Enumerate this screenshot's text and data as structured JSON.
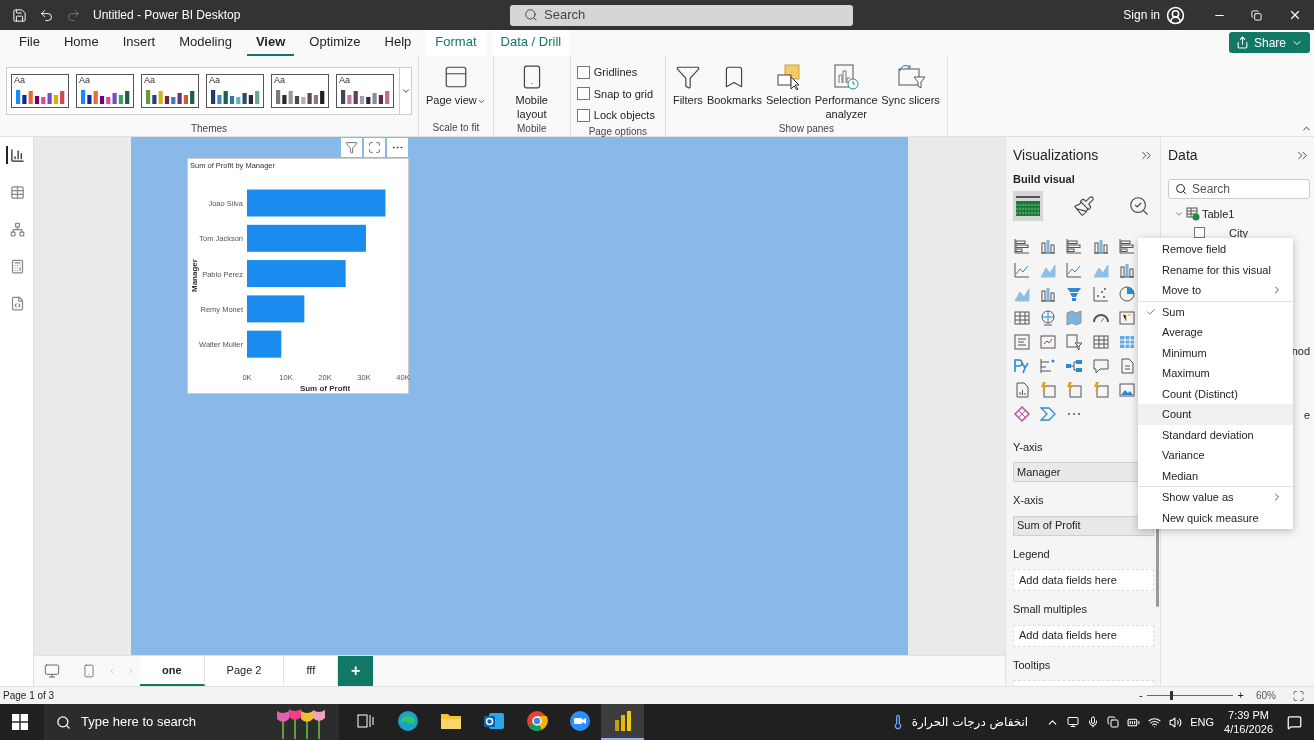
{
  "title_bar": {
    "title": "Untitled - Power BI Desktop",
    "search_placeholder": "Search",
    "sign_in": "Sign in"
  },
  "menu_tabs": [
    {
      "label": "File",
      "kind": "main",
      "selected": false
    },
    {
      "label": "Home",
      "kind": "main",
      "selected": false
    },
    {
      "label": "Insert",
      "kind": "main",
      "selected": false
    },
    {
      "label": "Modeling",
      "kind": "main",
      "selected": false
    },
    {
      "label": "View",
      "kind": "main",
      "selected": true
    },
    {
      "label": "Optimize",
      "kind": "main",
      "selected": false
    },
    {
      "label": "Help",
      "kind": "main",
      "selected": false
    },
    {
      "label": "Format",
      "kind": "contextual",
      "selected": false
    },
    {
      "label": "Data / Drill",
      "kind": "contextual",
      "selected": false
    }
  ],
  "share": "Share",
  "ribbon": {
    "themes_label": "Themes",
    "theme_swatches": [
      {
        "sample": "Aa"
      },
      {
        "sample": "Aa"
      },
      {
        "sample": "Aa"
      },
      {
        "sample": "Aa"
      },
      {
        "sample": "Aa"
      },
      {
        "sample": "Aa"
      }
    ],
    "groups": [
      {
        "label": "Scale to fit",
        "buttons": [
          {
            "label": "Page view",
            "kind": "page-view",
            "dropdown": true
          }
        ]
      },
      {
        "label": "Mobile",
        "buttons": [
          {
            "label": "Mobile layout",
            "kind": "mobile",
            "dropdown": false
          }
        ]
      },
      {
        "label": "Page options",
        "checkboxes": [
          {
            "label": "Gridlines",
            "checked": false
          },
          {
            "label": "Snap to grid",
            "checked": false
          },
          {
            "label": "Lock objects",
            "checked": false
          }
        ]
      },
      {
        "label": "Show panes",
        "buttons": [
          {
            "label": "Filters",
            "kind": "filters",
            "dropdown": false
          },
          {
            "label": "Bookmarks",
            "kind": "bookmarks",
            "dropdown": false
          },
          {
            "label": "Selection",
            "kind": "selection",
            "dropdown": false
          },
          {
            "label": "Performance analyzer",
            "kind": "performance",
            "dropdown": false
          },
          {
            "label": "Sync slicers",
            "kind": "sync",
            "dropdown": false
          }
        ]
      }
    ]
  },
  "left_rail": [
    {
      "kind": "report",
      "selected": true
    },
    {
      "kind": "table",
      "selected": false
    },
    {
      "kind": "model",
      "selected": false
    },
    {
      "kind": "dax",
      "selected": false
    },
    {
      "kind": "tmdl",
      "selected": false
    }
  ],
  "visual": {
    "title": "Sum of Profit by Manager",
    "chart_data": {
      "type": "bar",
      "orientation": "horizontal",
      "xlabel": "Sum of Profit",
      "ylabel": "Manager",
      "categories": [
        "Joao Silva",
        "Tom Jackson",
        "Pablo Perez",
        "Remy Monet",
        "Walter Muller"
      ],
      "series": [
        {
          "color": "#1a8cf0",
          "values": [
            35500,
            30500,
            25300,
            14700,
            8800
          ]
        }
      ],
      "xlim": [
        0,
        40000
      ],
      "xticks": [
        {
          "value": 0,
          "label": "0K"
        },
        {
          "value": 10000,
          "label": "10K"
        },
        {
          "value": 20000,
          "label": "20K"
        },
        {
          "value": 30000,
          "label": "30K"
        },
        {
          "value": 40000,
          "label": "40K"
        }
      ]
    }
  },
  "page_tabs": {
    "tabs": [
      {
        "label": "one",
        "selected": true
      },
      {
        "label": "Page 2",
        "selected": false
      },
      {
        "label": "fff",
        "selected": false
      }
    ],
    "add_label": "+"
  },
  "visualizations": {
    "title": "Visualizations",
    "subtitle": "Build visual",
    "modes": [
      {
        "kind": "build",
        "selected": true
      },
      {
        "kind": "format",
        "selected": false
      },
      {
        "kind": "analytics",
        "selected": false
      }
    ],
    "wells": [
      {
        "label": "Y-axis",
        "value": "Manager"
      },
      {
        "label": "X-axis",
        "value": "Sum of Profit"
      },
      {
        "label": "Legend",
        "empty_text": "Add data fields here"
      },
      {
        "label": "Small multiples",
        "empty_text": "Add data fields here"
      },
      {
        "label": "Tooltips"
      }
    ]
  },
  "data_pane": {
    "title": "Data",
    "search_placeholder": "Search",
    "tables": [
      {
        "label": "Table1",
        "expanded": true,
        "fields": [
          {
            "label": "City",
            "kind": "field",
            "checked": false
          },
          {
            "label": "nod",
            "kind": "partial"
          },
          {
            "label": "e",
            "kind": "partial"
          }
        ]
      }
    ]
  },
  "context_menu": {
    "sections": [
      [
        {
          "label": "Remove field",
          "kind": "action",
          "highlighted": false
        },
        {
          "label": "Rename for this visual",
          "kind": "action",
          "highlighted": false
        },
        {
          "label": "Move to",
          "kind": "submenu",
          "highlighted": false
        }
      ],
      [
        {
          "label": "Sum",
          "kind": "aggregation",
          "checked": true,
          "highlighted": false
        },
        {
          "label": "Average",
          "kind": "aggregation",
          "checked": false,
          "highlighted": false
        },
        {
          "label": "Minimum",
          "kind": "aggregation",
          "checked": false,
          "highlighted": false
        },
        {
          "label": "Maximum",
          "kind": "aggregation",
          "checked": false,
          "highlighted": false
        },
        {
          "label": "Count (Distinct)",
          "kind": "aggregation",
          "checked": false,
          "highlighted": false
        },
        {
          "label": "Count",
          "kind": "aggregation",
          "checked": false,
          "highlighted": true
        },
        {
          "label": "Standard deviation",
          "kind": "aggregation",
          "checked": false,
          "highlighted": false
        },
        {
          "label": "Variance",
          "kind": "aggregation",
          "checked": false,
          "highlighted": false
        },
        {
          "label": "Median",
          "kind": "aggregation",
          "checked": false,
          "highlighted": false
        }
      ],
      [
        {
          "label": "Show value as",
          "kind": "submenu",
          "highlighted": false
        },
        {
          "label": "New quick measure",
          "kind": "action",
          "highlighted": false
        }
      ]
    ]
  },
  "status_bar": {
    "page_info": "Page 1 of 3",
    "zoom_out": "-",
    "zoom_in": "+",
    "zoom": {
      "level": 0.27
    },
    "zoom_text": "60%"
  },
  "taskbar": {
    "search_placeholder": "Type here to search",
    "apps": [
      {
        "kind": "task-view",
        "selected": false
      },
      {
        "kind": "edge",
        "selected": false
      },
      {
        "kind": "explorer",
        "selected": false
      },
      {
        "kind": "outlook",
        "selected": false
      },
      {
        "kind": "chrome",
        "selected": false
      },
      {
        "kind": "zoom",
        "selected": false
      },
      {
        "kind": "powerbi",
        "selected": true
      }
    ],
    "weather": "انخفاض درجات الحرارة",
    "language": "ENG",
    "time": "7:39 PM",
    "date": "4/16/2026"
  }
}
